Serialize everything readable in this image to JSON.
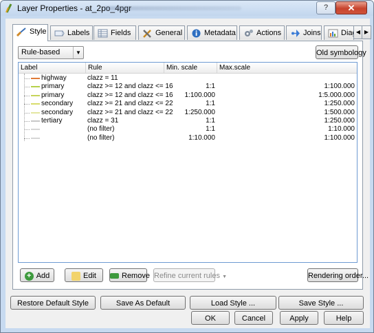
{
  "window": {
    "title": "Layer Properties - at_2po_4pgr"
  },
  "tabs": [
    {
      "label": "Style",
      "icon": "brush-icon"
    },
    {
      "label": "Labels",
      "icon": "labels-icon"
    },
    {
      "label": "Fields",
      "icon": "table-icon"
    },
    {
      "label": "General",
      "icon": "tools-icon"
    },
    {
      "label": "Metadata",
      "icon": "info-icon"
    },
    {
      "label": "Actions",
      "icon": "gear-icon"
    },
    {
      "label": "Joins",
      "icon": "join-icon"
    },
    {
      "label": "Diagra",
      "icon": "diagram-icon"
    }
  ],
  "style": {
    "renderer": "Rule-based",
    "old_symbology": "Old symbology"
  },
  "rules_table": {
    "columns": [
      "Label",
      "Rule",
      "Min. scale",
      "Max.scale"
    ],
    "rows": [
      {
        "label": "highway",
        "rule": "clazz = 11",
        "min": "",
        "max": "",
        "color": "#e07b39"
      },
      {
        "label": "primary",
        "rule": "clazz >= 12 and clazz <= 16",
        "min": "1:1",
        "max": "1:100.000",
        "color": "#b5d14a"
      },
      {
        "label": "primary",
        "rule": "clazz >= 12 and clazz <= 16",
        "min": "1:100.000",
        "max": "1:5.000.000",
        "color": "#c6d45a"
      },
      {
        "label": "secondary",
        "rule": "clazz >= 21 and clazz <= 22",
        "min": "1:1",
        "max": "1:250.000",
        "color": "#d8dc6a"
      },
      {
        "label": "secondary",
        "rule": "clazz >= 21 and clazz <= 22",
        "min": "1:250.000",
        "max": "1:500.000",
        "color": "#e3e6a0"
      },
      {
        "label": "tertiary",
        "rule": "clazz = 31",
        "min": "1:1",
        "max": "1:250.000",
        "color": "#c8c8c8"
      },
      {
        "label": "",
        "rule": "(no filter)",
        "min": "1:1",
        "max": "1:10.000",
        "color": "#d6d6d6"
      },
      {
        "label": "",
        "rule": "(no filter)",
        "min": "1:10.000",
        "max": "1:100.000",
        "color": "#d6d6d6"
      }
    ]
  },
  "rule_buttons": {
    "add": "Add",
    "edit": "Edit",
    "remove": "Remove",
    "refine": "Refine current rules",
    "rendering_order": "Rendering order..."
  },
  "bottom_buttons": {
    "restore_default": "Restore Default Style",
    "save_default": "Save As Default",
    "load_style": "Load Style ...",
    "save_style": "Save Style ...",
    "ok": "OK",
    "cancel": "Cancel",
    "apply": "Apply",
    "help": "Help"
  },
  "title_buttons": {
    "help": "?",
    "close": "✕"
  }
}
